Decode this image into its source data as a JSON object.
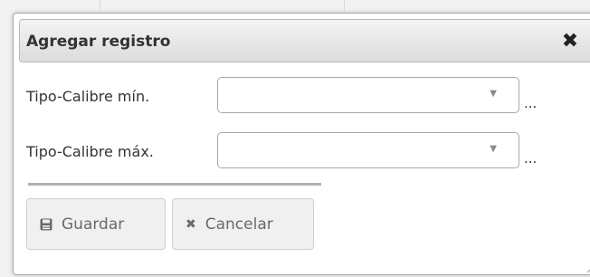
{
  "dialog": {
    "title": "Agregar registro",
    "close_icon": "close-icon"
  },
  "form": {
    "fields": [
      {
        "label": "Tipo-Calibre mín.",
        "value": "",
        "more": "..."
      },
      {
        "label": "Tipo-Calibre máx.",
        "value": "",
        "more": "..."
      }
    ]
  },
  "buttons": {
    "save_label": "Guardar",
    "save_icon": "save-icon",
    "cancel_label": "Cancelar",
    "cancel_icon": "cancel-icon"
  },
  "colors": {
    "titlebar_bg": "#e0e0e0",
    "text": "#333333",
    "button_text": "#6a6a6a",
    "border": "#a8a8a8"
  }
}
